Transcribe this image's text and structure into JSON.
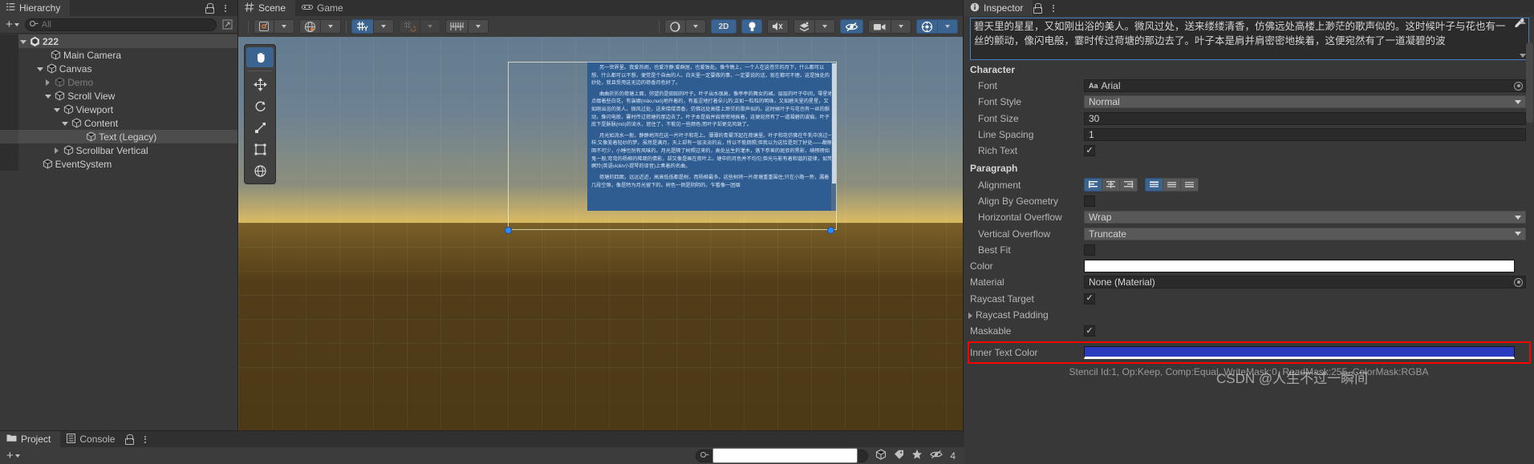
{
  "hierarchy": {
    "tab_label": "Hierarchy",
    "tab_icon": "hierarchy-icon",
    "add_label": "+",
    "search_placeholder": "All",
    "items": [
      {
        "label": "222",
        "depth": 0,
        "arrow": "down",
        "icon": "unity-scene-icon",
        "selected": false,
        "dim": false,
        "bold": true
      },
      {
        "label": "Main Camera",
        "depth": 2,
        "arrow": "none",
        "icon": "gameobject-icon",
        "selected": false,
        "dim": false,
        "bold": false
      },
      {
        "label": "Canvas",
        "depth": 1.6,
        "arrow": "down",
        "icon": "gameobject-icon",
        "selected": false,
        "dim": false,
        "bold": false
      },
      {
        "label": "Demo",
        "depth": 2.4,
        "arrow": "right",
        "icon": "gameobject-icon",
        "selected": false,
        "dim": true,
        "bold": false
      },
      {
        "label": "Scroll View",
        "depth": 2.4,
        "arrow": "down",
        "icon": "gameobject-icon",
        "selected": false,
        "dim": false,
        "bold": false
      },
      {
        "label": "Viewport",
        "depth": 3.2,
        "arrow": "down",
        "icon": "gameobject-icon",
        "selected": false,
        "dim": false,
        "bold": false
      },
      {
        "label": "Content",
        "depth": 4.0,
        "arrow": "down",
        "icon": "gameobject-icon",
        "selected": false,
        "dim": false,
        "bold": false
      },
      {
        "label": "Text (Legacy)",
        "depth": 5.4,
        "arrow": "none",
        "icon": "gameobject-icon",
        "selected": true,
        "dim": false,
        "bold": false
      },
      {
        "label": "Scrollbar Vertical",
        "depth": 3.2,
        "arrow": "right",
        "icon": "gameobject-icon",
        "selected": false,
        "dim": false,
        "bold": false
      },
      {
        "label": "EventSystem",
        "depth": 1.2,
        "arrow": "none",
        "icon": "gameobject-icon",
        "selected": false,
        "dim": false,
        "bold": false
      }
    ]
  },
  "scene": {
    "tabs": [
      {
        "label": "Scene",
        "icon": "scene-grid-icon",
        "active": true
      },
      {
        "label": "Game",
        "icon": "gamepad-icon",
        "active": false
      }
    ],
    "toolbar": {
      "pivot_icon": "pivot-center-icon",
      "handle_icon": "global-handle-icon",
      "grid_snap_icon": "grid-snap-y-icon",
      "grid_snap_label": "Y",
      "snap_increment_icon": "snap-increment-icon",
      "ruler_icon": "ruler-icon",
      "shading_icon": "shaded-mode-icon",
      "mode_2d_label": "2D",
      "lighting_icon": "lightbulb-icon",
      "audio_icon": "audio-mute-icon",
      "fx_icon": "effects-icon",
      "visibility_icon": "scene-visibility-off-icon",
      "camera_icon": "scene-camera-icon",
      "gizmos_icon": "gizmos-icon"
    },
    "tools": [
      {
        "name": "hand-tool",
        "active": true
      },
      {
        "name": "move-tool",
        "active": false
      },
      {
        "name": "rotate-tool",
        "active": false
      },
      {
        "name": "scale-tool",
        "active": false
      },
      {
        "name": "rect-tool",
        "active": false
      },
      {
        "name": "transform-tool",
        "active": false
      }
    ],
    "text_object": {
      "paragraphs": [
        "另一世界里。我爱热闹，也爱冷静;爱群居，也爱独处。像今晚上，一个人在这苍茫的月下，什么都可以想，什么都可以不想，便觉是个自由的人。白天里一定要做的事，一定要说的话，现在都可不理。这是独处的妙处，我且受用这无边的荷香月色好了。",
        "曲曲折折的荷塘上面，弥望的是田田的叶子。叶子出水很高，像亭亭的舞女的裙。层层的叶子中间，零星地点缀着些白花，有袅娜(niǎo,nuó)地开着的，有羞涩地打着朵儿的;正如一粒粒的明珠，又如碧天里的星星，又如刚出浴的美人。微风过处，送来缕缕清香，仿佛远处高楼上渺茫的歌声似的。这时候叶子与花也有一丝的颤动，像闪电般，霎时传过荷塘的那边去了。叶子本是肩并肩密密地挨着，这便宛然有了一道凝碧的波痕。叶子底下是脉脉(mò)的流水，遮住了，不能见一些颜色;而叶子却更见风致了。",
        "月光如流水一般，静静地泻在这一片叶子和花上。薄薄的青雾浮起在荷塘里。叶子和花仿佛在牛乳中洗过一样;又像笼着轻纱的梦。虽然是满月，天上却有一层淡淡的云，所以不能朗照;但我以为这恰是到了好处——酣眠固不可少，小睡也别有风味的。月光是隔了树照过来的，高处丛生的灌木，落下参差的斑驳的黑影，峭楞楞如鬼一般;弯弯的杨柳的稀疏的倩影，却又像是画在荷叶上。塘中的月色并不均匀;但光与影有着和谐的旋律，如梵婀玲(英语violin小提琴的译音)上奏着的名曲。",
        "荷塘的四面，远远近近，高高低低都是树，而杨柳最多。这些树将一片荷塘重重围住;只在小路一旁，漏着几段空隙，像是特为月光留下的。树色一例是阴阴的，乍看像一团烟"
      ]
    }
  },
  "inspector": {
    "tab_label": "Inspector",
    "tab_icon": "info-icon",
    "lock_icon": "lock-icon",
    "menu_icon": "kebab-menu-icon",
    "text_value": "碧天里的星星，又如刚出浴的美人。微风过处，送来缕缕清香，仿佛远处高楼上渺茫的歌声似的。这时候叶子与花也有一丝的颤动，像闪电般，霎时传过荷塘的那边去了。叶子本是肩并肩密密地挨着，这便宛然有了一道凝碧的波",
    "sections": {
      "character": "Character",
      "paragraph": "Paragraph"
    },
    "fields": {
      "font_label": "Font",
      "font_value": "Arial",
      "font_icon": "font-asset-icon",
      "font_style_label": "Font Style",
      "font_style_value": "Normal",
      "font_size_label": "Font Size",
      "font_size_value": "30",
      "line_spacing_label": "Line Spacing",
      "line_spacing_value": "1",
      "rich_text_label": "Rich Text",
      "rich_text_checked": "✓",
      "alignment_label": "Alignment",
      "align_by_geometry_label": "Align By Geometry",
      "horizontal_overflow_label": "Horizontal Overflow",
      "horizontal_overflow_value": "Wrap",
      "vertical_overflow_label": "Vertical Overflow",
      "vertical_overflow_value": "Truncate",
      "best_fit_label": "Best Fit",
      "color_label": "Color",
      "color_value": "#FFFFFF",
      "material_label": "Material",
      "material_value": "None (Material)",
      "raycast_target_label": "Raycast Target",
      "raycast_target_checked": "✓",
      "raycast_padding_label": "Raycast Padding",
      "maskable_label": "Maskable",
      "maskable_checked": "✓",
      "inner_text_color_label": "Inner Text Color",
      "inner_text_color_value": "#2B3BBF"
    },
    "stencil_text": "Stencil Id:1, Op:Keep, Comp:Equal, WriteMask:0, ReadMask:255, ColorMask:RGBA",
    "watermark": "CSDN @人生不过一瞬间",
    "highlight_color": "#ff0000"
  },
  "project": {
    "tabs": [
      {
        "label": "Project",
        "icon": "folder-icon",
        "active": true
      },
      {
        "label": "Console",
        "icon": "console-icon",
        "active": false
      }
    ],
    "add_label": "+",
    "search_placeholder": "",
    "search_icon": "search-icon",
    "right_icons": [
      "package-icon",
      "favorites-star-icon",
      "hidden-eye-icon"
    ],
    "hidden_count": "4"
  }
}
